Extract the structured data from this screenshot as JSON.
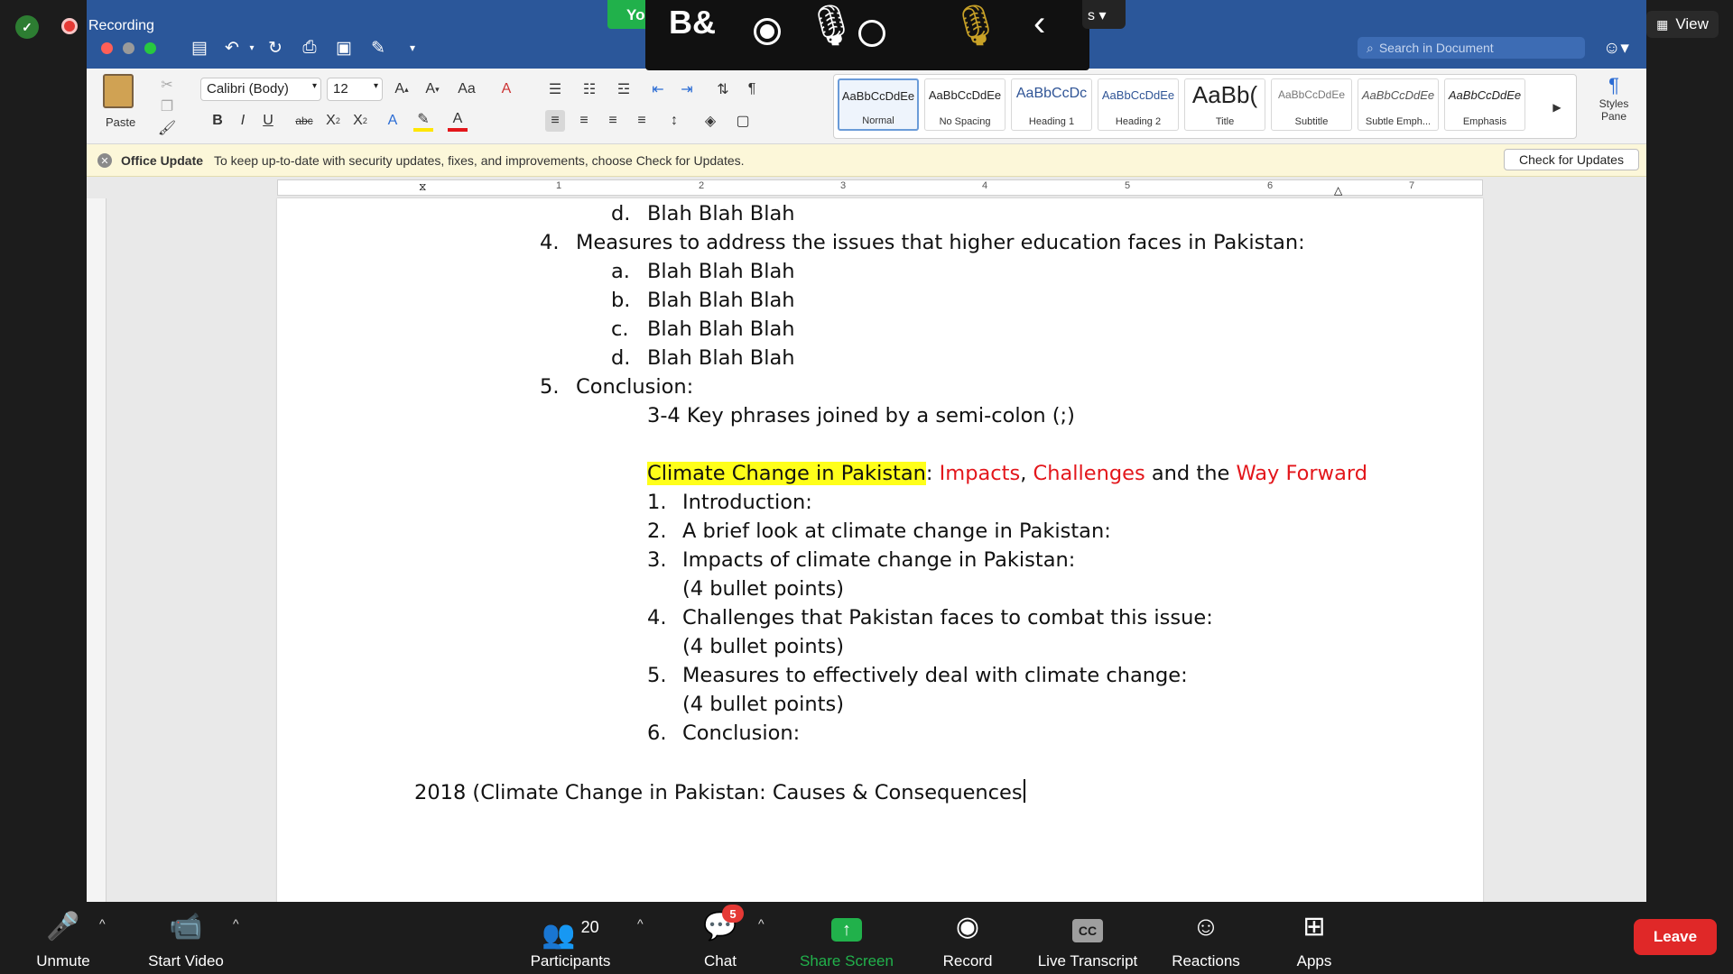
{
  "zoom": {
    "recording_label": "Recording",
    "view_label": "View",
    "overlay_tab_green": "Yo",
    "overlay_tab_s": "s",
    "toolbar": {
      "unmute": "Unmute",
      "start_video": "Start Video",
      "participants": "Participants",
      "participants_count": "20",
      "chat": "Chat",
      "chat_badge": "5",
      "share_screen": "Share Screen",
      "record": "Record",
      "live_transcript": "Live Transcript",
      "reactions": "Reactions",
      "apps": "Apps",
      "leave": "Leave"
    },
    "colors": {
      "share_green": "#21b14b",
      "leave_red": "#e02828",
      "badge_red": "#e53935"
    }
  },
  "word": {
    "title_recording": "Recording",
    "search_placeholder": "Search in Document",
    "paste_label": "Paste",
    "font_name": "Calibri (Body)",
    "font_size": "12",
    "styles": [
      {
        "sample": "AaBbCcDdEe",
        "name": "Normal"
      },
      {
        "sample": "AaBbCcDdEe",
        "name": "No Spacing"
      },
      {
        "sample": "AaBbCcDc",
        "name": "Heading 1"
      },
      {
        "sample": "AaBbCcDdEe",
        "name": "Heading 2"
      },
      {
        "sample": "AaBb(",
        "name": "Title"
      },
      {
        "sample": "AaBbCcDdEe",
        "name": "Subtitle"
      },
      {
        "sample": "AaBbCcDdEe",
        "name": "Subtle Emph..."
      },
      {
        "sample": "AaBbCcDdEe",
        "name": "Emphasis"
      }
    ],
    "styles_pane_label": "Styles Pane",
    "update_bar": {
      "title": "Office Update",
      "message": "To keep up-to-date with security updates, fixes, and improvements, choose Check for Updates.",
      "button": "Check for Updates"
    },
    "ruler_numbers": [
      "1",
      "1",
      "2",
      "3",
      "4",
      "5",
      "6",
      "7"
    ],
    "accent": "#2b579a"
  },
  "document": {
    "lines": [
      {
        "marker": "d.",
        "text": "Blah Blah Blah"
      },
      {
        "marker": "4.",
        "text": "Measures to address the issues that higher education faces in Pakistan:"
      },
      {
        "marker": "a.",
        "text": "Blah Blah Blah"
      },
      {
        "marker": "b.",
        "text": "Blah Blah Blah"
      },
      {
        "marker": "c.",
        "text": "Blah Blah Blah"
      },
      {
        "marker": "d.",
        "text": "Blah Blah Blah"
      },
      {
        "marker": "5.",
        "text": "Conclusion:"
      },
      {
        "marker": "",
        "text": "3-4 Key phrases joined by a semi-colon (;)"
      }
    ],
    "title_line": {
      "highlight": "Climate Change in Pakistan",
      "colon": ": ",
      "impacts": "Impacts",
      "comma": ", ",
      "challenges": "Challenges",
      "and_the": " and the ",
      "way_forward": "Way Forward"
    },
    "outline": [
      {
        "marker": "1.",
        "text": "Introduction:",
        "sub": ""
      },
      {
        "marker": "2.",
        "text": "A brief look at climate change in Pakistan:",
        "sub": ""
      },
      {
        "marker": "3.",
        "text": "Impacts of climate change in Pakistan:",
        "sub": "(4 bullet points)"
      },
      {
        "marker": "4.",
        "text": "Challenges that Pakistan faces to combat this issue:",
        "sub": "(4 bullet points)"
      },
      {
        "marker": "5.",
        "text": "Measures to effectively deal with climate change:",
        "sub": "(4 bullet points)"
      },
      {
        "marker": "6.",
        "text": "Conclusion:",
        "sub": ""
      }
    ],
    "last_line": "2018 (Climate Change in Pakistan: Causes & Consequences"
  }
}
